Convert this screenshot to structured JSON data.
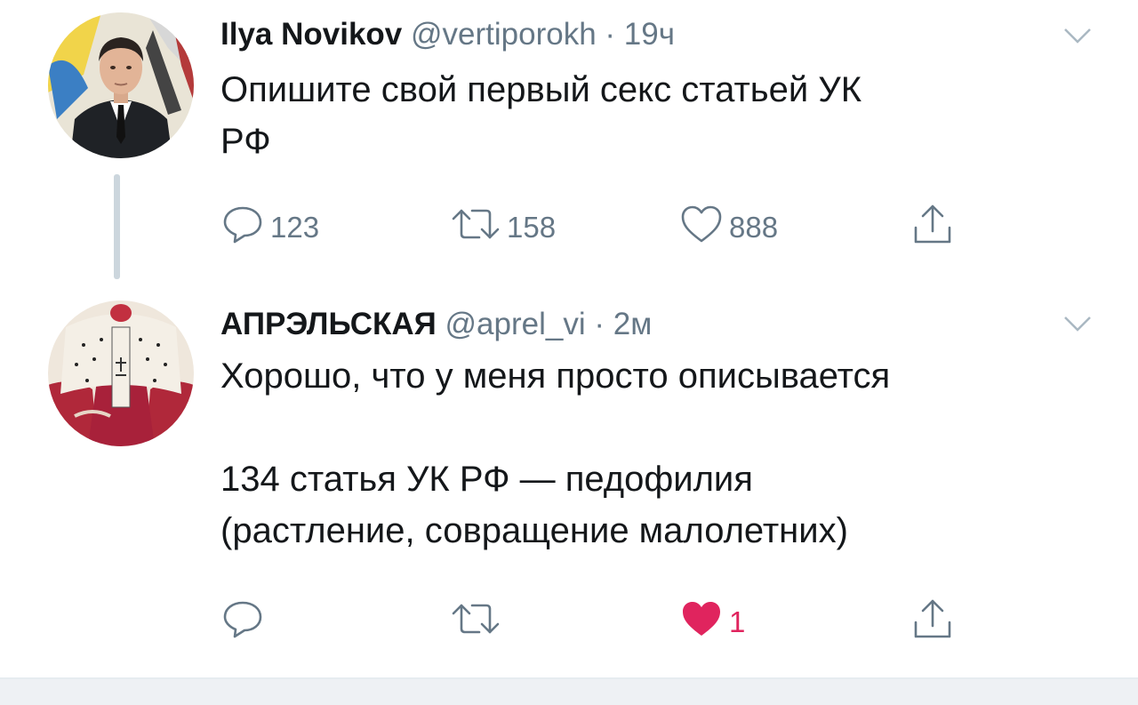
{
  "tweets": [
    {
      "name": "Ilya Novikov",
      "handle": "@vertiporokh",
      "separator": "·",
      "time": "19ч",
      "text": "Опишите свой первый секс статьей УК\nРФ",
      "actions": {
        "reply": "123",
        "retweet": "158",
        "like": "888"
      },
      "liked": false
    },
    {
      "name": "АПРЭЛЬСКАЯ",
      "handle": "@aprel_vi",
      "separator": "·",
      "time": "2м",
      "text": "Хорошо, что у меня просто описывается\n\n134 статья УК РФ — педофилия\n(растление, совращение малолетних)",
      "actions": {
        "reply": "",
        "retweet": "",
        "like": "1"
      },
      "liked": true
    }
  ],
  "icons": {
    "reply": "reply-icon",
    "retweet": "retweet-icon",
    "like": "heart-icon",
    "share": "share-icon",
    "menu": "chevron-down-icon"
  },
  "colors": {
    "text": "#14171a",
    "secondary": "#657786",
    "like_active": "#e0245e",
    "thread_line": "#ccd6dd"
  }
}
